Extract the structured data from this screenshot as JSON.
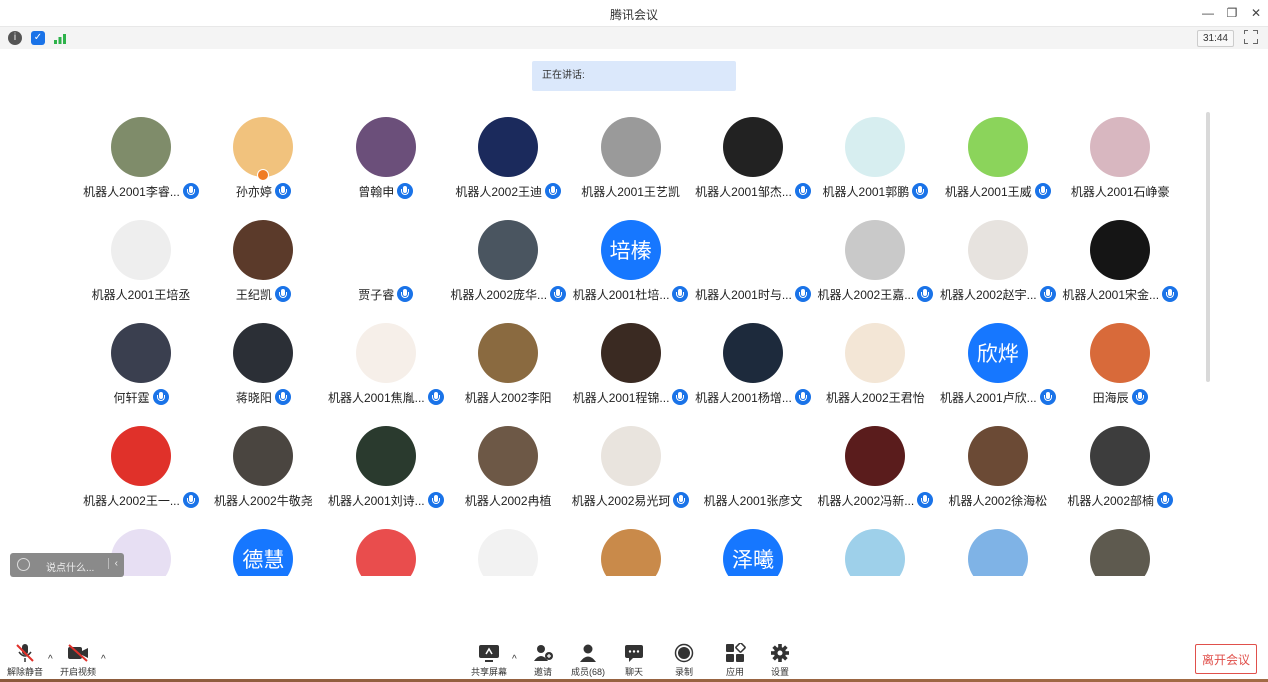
{
  "window": {
    "title": "腾讯会议"
  },
  "infobar": {
    "timer": "31:44"
  },
  "speaking": {
    "label": "正在讲话:"
  },
  "chat": {
    "placeholder": "说点什么..."
  },
  "colors": {
    "accent": "#1a73e8",
    "leave": "#e0504b"
  },
  "participants": [
    {
      "name": "机器人2001李睿...",
      "mic": true,
      "color": "#7f8c6a"
    },
    {
      "name": "孙亦婷",
      "mic": true,
      "color": "#f1c27d",
      "badge": true
    },
    {
      "name": "曾翰申",
      "mic": true,
      "color": "#6b4f7a"
    },
    {
      "name": "机器人2002王迪",
      "mic": true,
      "color": "#1b2a5c"
    },
    {
      "name": "机器人2001王艺凯",
      "mic": false,
      "color": "#9a9a9a"
    },
    {
      "name": "机器人2001邹杰...",
      "mic": true,
      "color": "#222222"
    },
    {
      "name": "机器人2001郭鹏",
      "mic": true,
      "color": "#d7eef0"
    },
    {
      "name": "机器人2001王威",
      "mic": true,
      "color": "#8bd45b"
    },
    {
      "name": "机器人2001石峥豪",
      "mic": false,
      "color": "#d8b7c0"
    },
    {
      "name": "机器人2001王培丞",
      "mic": false,
      "color": "#eeeeee"
    },
    {
      "name": "王纪凯",
      "mic": true,
      "color": "#5b3a2a"
    },
    {
      "name": "贾子睿",
      "mic": true,
      "color": "#ffffff"
    },
    {
      "name": "机器人2002庞华...",
      "mic": true,
      "color": "#4a5560"
    },
    {
      "name": "机器人2001杜培...",
      "mic": true,
      "color": "#1677ff",
      "text": "培榛"
    },
    {
      "name": "机器人2001时与...",
      "mic": true,
      "color": "#ffffff"
    },
    {
      "name": "机器人2002王嘉...",
      "mic": true,
      "color": "#c9c9c9"
    },
    {
      "name": "机器人2002赵宇...",
      "mic": true,
      "color": "#e7e3df"
    },
    {
      "name": "机器人2001宋金...",
      "mic": true,
      "color": "#151515"
    },
    {
      "name": "何轩霆",
      "mic": true,
      "color": "#3a3f4f"
    },
    {
      "name": "蒋晓阳",
      "mic": true,
      "color": "#2b2f36"
    },
    {
      "name": "机器人2001焦胤...",
      "mic": true,
      "color": "#f6efe9"
    },
    {
      "name": "机器人2002李阳",
      "mic": false,
      "color": "#8a6a40"
    },
    {
      "name": "机器人2001程锦...",
      "mic": true,
      "color": "#3a2a22"
    },
    {
      "name": "机器人2001杨增...",
      "mic": true,
      "color": "#1d2a3c"
    },
    {
      "name": "机器人2002王君怡",
      "mic": false,
      "color": "#f3e6d6"
    },
    {
      "name": "机器人2001卢欣...",
      "mic": true,
      "color": "#1677ff",
      "text": "欣烨"
    },
    {
      "name": "田海辰",
      "mic": true,
      "color": "#d86a3a"
    },
    {
      "name": "机器人2002王一...",
      "mic": true,
      "color": "#e0312a"
    },
    {
      "name": "机器人2002牛敬尧",
      "mic": false,
      "color": "#4a4540"
    },
    {
      "name": "机器人2001刘诗...",
      "mic": true,
      "color": "#2a3a2e"
    },
    {
      "name": "机器人2002冉植",
      "mic": false,
      "color": "#6d5846"
    },
    {
      "name": "机器人2002易光珂",
      "mic": true,
      "color": "#e9e4de"
    },
    {
      "name": "机器人2001张彦文",
      "mic": false,
      "color": "#ffffff"
    },
    {
      "name": "机器人2002冯新...",
      "mic": true,
      "color": "#5a1c1c"
    },
    {
      "name": "机器人2002徐海松",
      "mic": false,
      "color": "#6b4a35"
    },
    {
      "name": "机器人2002部楠",
      "mic": true,
      "color": "#3d3d3d"
    },
    {
      "name": "",
      "mic": false,
      "color": "#e7dff3"
    },
    {
      "name": "",
      "mic": false,
      "color": "#1677ff",
      "text": "德慧"
    },
    {
      "name": "",
      "mic": false,
      "color": "#e94d4d"
    },
    {
      "name": "",
      "mic": false,
      "color": "#f2f2f2"
    },
    {
      "name": "",
      "mic": false,
      "color": "#c98a4a"
    },
    {
      "name": "",
      "mic": false,
      "color": "#1677ff",
      "text": "泽曦"
    },
    {
      "name": "",
      "mic": false,
      "color": "#9ed0ea"
    },
    {
      "name": "",
      "mic": false,
      "color": "#7fb3e6"
    },
    {
      "name": "",
      "mic": false,
      "color": "#5e5a4f"
    }
  ],
  "toolbar": {
    "unmute": "解除静音",
    "video": "开启视频",
    "share": "共享屏幕",
    "invite": "邀请",
    "members": "成员(68)",
    "chat": "聊天",
    "record": "录制",
    "apps": "应用",
    "settings": "设置",
    "leave": "离开会议"
  }
}
